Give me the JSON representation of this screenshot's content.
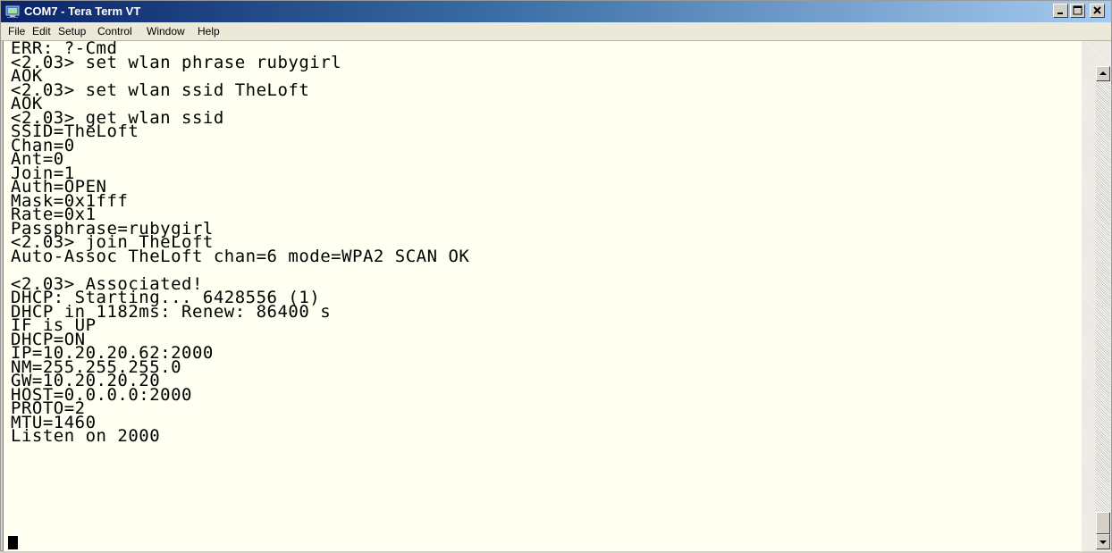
{
  "window": {
    "title": "COM7 - Tera Term VT",
    "icon": "tera-term-app-icon"
  },
  "menu": {
    "items": [
      "File",
      "Edit",
      "Setup",
      "Control",
      "Window",
      "Help"
    ]
  },
  "terminal": {
    "lines": [
      "ERR: ?-Cmd",
      "<2.03> set wlan phrase rubygirl",
      "AOK",
      "<2.03> set wlan ssid TheLoft",
      "AOK",
      "<2.03> get wlan ssid",
      "SSID=TheLoft",
      "Chan=0",
      "Ant=0",
      "Join=1",
      "Auth=OPEN",
      "Mask=0x1fff",
      "Rate=0x1",
      "Passphrase=rubygirl",
      "<2.03> join TheLoft",
      "Auto-Assoc TheLoft chan=6 mode=WPA2 SCAN OK",
      "",
      "<2.03> Associated!",
      "DHCP: Starting... 6428556 (1)",
      "DHCP in 1182ms: Renew: 86400 s",
      "IF is UP",
      "DHCP=ON",
      "IP=10.20.20.62:2000",
      "NM=255.255.255.0",
      "GW=10.20.20.20",
      "HOST=0.0.0.0:2000",
      "PROTO=2",
      "MTU=1460",
      "Listen on 2000"
    ],
    "background": "#fffff2",
    "foreground": "#000000"
  },
  "colors": {
    "titlebar_start": "#0a246a",
    "titlebar_end": "#a6caf0"
  }
}
